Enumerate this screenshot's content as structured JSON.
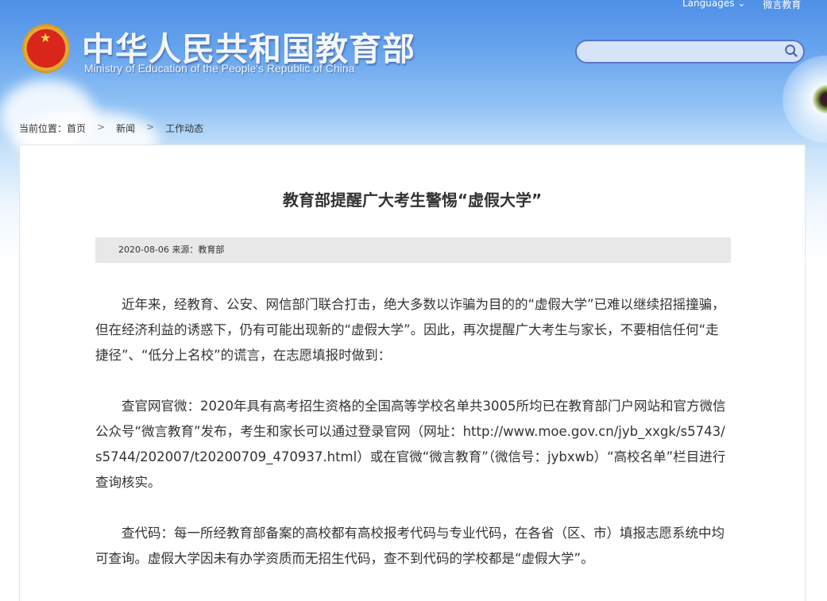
{
  "header": {
    "title_cn": "中华人民共和国教育部",
    "title_en": "Ministry of Education of the People's Republic of China",
    "languages": "Languages",
    "weiyan": "微言教育",
    "search_placeholder": ""
  },
  "breadcrumb": {
    "label": "当前位置：",
    "items": [
      "首页",
      "新闻",
      "工作动态"
    ]
  },
  "article": {
    "title": "教育部提醒广大考生警惕“虚假大学”",
    "date": "2020-08-06",
    "source": "来源：教育部",
    "paragraphs": [
      "近年来，经教育、公安、网信部门联合打击，绝大多数以诈骗为目的的“虚假大学”已难以继续招摇撞骗，但在经济利益的诱惑下，仍有可能出现新的“虚假大学”。因此，再次提醒广大考生与家长，不要相信任何“走捷径”、“低分上名校”的谎言，在志愿填报时做到：",
      "查官网官微：2020年具有高考招生资格的全国高等学校名单共3005所均已在教育部门户网站和官方微信公众号“微言教育”发布，考生和家长可以通过登录官网（网址：http://www.moe.gov.cn/jyb_xxgk/s5743/s5744/202007/t20200709_470937.html）或在官微“微言教育”（微信号：jybxwb）“高校名单”栏目进行查询核实。",
      "查代码：每一所经教育部备案的高校都有高校报考代码与专业代码，在各省（区、市）填报志愿系统中均可查询。虚假大学因未有办学资质而无招生代码，查不到代码的学校都是“虚假大学”。"
    ]
  }
}
